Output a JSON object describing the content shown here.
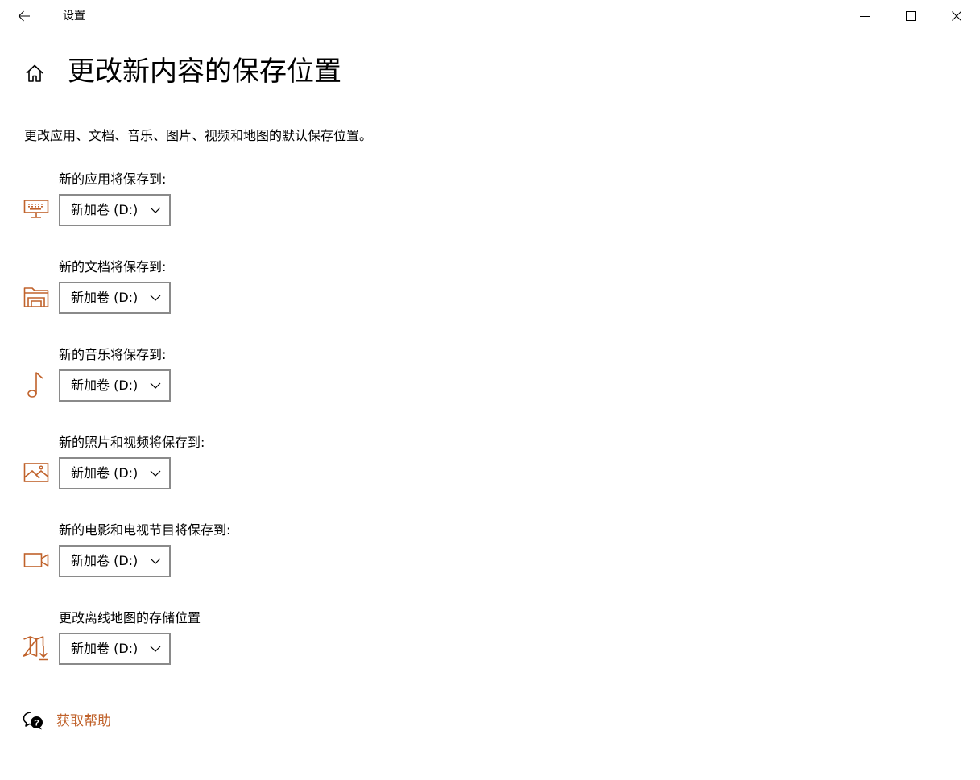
{
  "window": {
    "title": "设置"
  },
  "page": {
    "title": "更改新内容的保存位置",
    "description": "更改应用、文档、音乐、图片、视频和地图的默认保存位置。"
  },
  "colors": {
    "accent": "#c0622b",
    "border": "#8a8a8a"
  },
  "settings": [
    {
      "label": "新的应用将保存到:",
      "value": "新加卷 (D:)",
      "icon": "monitor-keyboard-icon"
    },
    {
      "label": "新的文档将保存到:",
      "value": "新加卷 (D:)",
      "icon": "folder-documents-icon"
    },
    {
      "label": "新的音乐将保存到:",
      "value": "新加卷 (D:)",
      "icon": "music-note-icon"
    },
    {
      "label": "新的照片和视频将保存到:",
      "value": "新加卷 (D:)",
      "icon": "picture-icon"
    },
    {
      "label": "新的电影和电视节目将保存到:",
      "value": "新加卷 (D:)",
      "icon": "video-camera-icon"
    },
    {
      "label": "更改离线地图的存储位置",
      "value": "新加卷 (D:)",
      "icon": "map-download-icon"
    }
  ],
  "help": {
    "label": "获取帮助",
    "icon": "help-chat-icon"
  }
}
